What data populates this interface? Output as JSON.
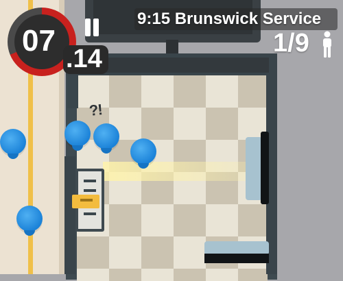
{
  "timer": {
    "minutes": "07",
    "seconds": ".14",
    "remaining_fraction": 0.69,
    "ring_color": "#c8211e"
  },
  "pause": {
    "icon": "pause-icon"
  },
  "service": {
    "title": "9:15 Brunswick Service"
  },
  "passengers": {
    "count": "1/9",
    "icon": "person-icon"
  },
  "scene": {
    "reaction_marks": "?!",
    "colors": {
      "passenger": "#1b82d8",
      "ticket": "#f3bc3e",
      "wall": "#39444a",
      "floor_light": "#e9e4d6",
      "floor_dark": "#cbc3b1",
      "bench": "#a7c2cf"
    }
  }
}
